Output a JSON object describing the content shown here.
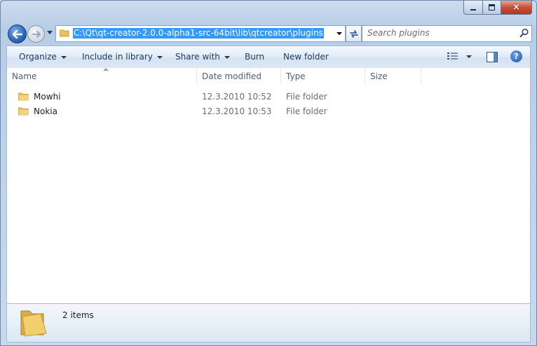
{
  "window": {
    "caption": {
      "minimize": "minimize",
      "maximize": "maximize",
      "close": "×"
    }
  },
  "address": {
    "path": "C:\\Qt\\qt-creator-2.0.0-alpha1-src-64bit\\lib\\qtcreator\\plugins"
  },
  "search": {
    "placeholder": "Search plugins"
  },
  "toolbar": {
    "organize": "Organize",
    "include_in_library": "Include in library",
    "share_with": "Share with",
    "burn": "Burn",
    "new_folder": "New folder",
    "help": "?"
  },
  "columns": {
    "name": "Name",
    "date_modified": "Date modified",
    "type": "Type",
    "size": "Size"
  },
  "files": [
    {
      "name": "Mowhi",
      "date": "12.3.2010 10:52",
      "type": "File folder",
      "size": ""
    },
    {
      "name": "Nokia",
      "date": "12.3.2010 10:53",
      "type": "File folder",
      "size": ""
    }
  ],
  "status": {
    "item_count": "2 items"
  },
  "colors": {
    "selection": "#3399ff",
    "folder": "#e8c25a"
  }
}
